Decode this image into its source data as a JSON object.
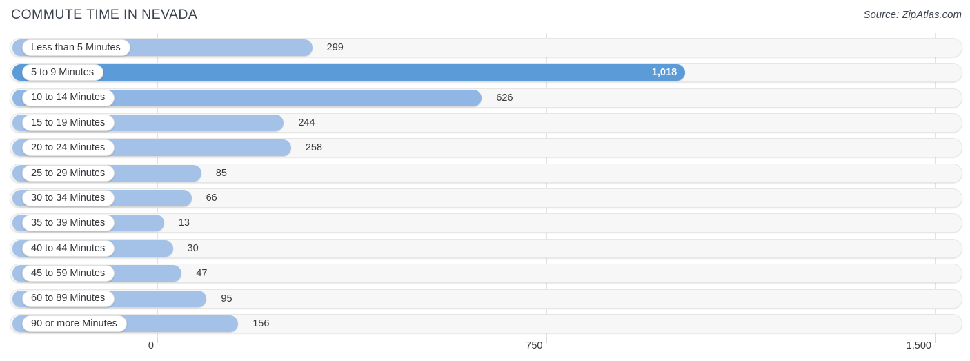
{
  "header": {
    "title": "COMMUTE TIME IN NEVADA",
    "source": "Source: ZipAtlas.com"
  },
  "colors": {
    "bar_light": "#a4c2e8",
    "bar_mid": "#8fb6e4",
    "bar_dark": "#5b9bd8",
    "track_bg": "#f7f7f7",
    "track_border": "#e6e6e6",
    "gridline": "#e3e3e3",
    "text": "#3a3a3a",
    "value_inside": "#ffffff"
  },
  "chart_data": {
    "type": "bar",
    "orientation": "horizontal",
    "title": "COMMUTE TIME IN NEVADA",
    "xlabel": "",
    "ylabel": "",
    "xlim": [
      0,
      1500
    ],
    "grid": true,
    "legend": "none",
    "axis_ticks": [
      {
        "value": 0,
        "label": "0"
      },
      {
        "value": 750,
        "label": "750"
      },
      {
        "value": 1500,
        "label": "1,500"
      }
    ],
    "categories": [
      "Less than 5 Minutes",
      "5 to 9 Minutes",
      "10 to 14 Minutes",
      "15 to 19 Minutes",
      "20 to 24 Minutes",
      "25 to 29 Minutes",
      "30 to 34 Minutes",
      "35 to 39 Minutes",
      "40 to 44 Minutes",
      "45 to 59 Minutes",
      "60 to 89 Minutes",
      "90 or more Minutes"
    ],
    "values": [
      299,
      1018,
      626,
      244,
      258,
      85,
      66,
      13,
      30,
      47,
      95,
      156
    ],
    "value_labels": [
      "299",
      "1,018",
      "626",
      "244",
      "258",
      "85",
      "66",
      "13",
      "30",
      "47",
      "95",
      "156"
    ],
    "bars": [
      {
        "label": "Less than 5 Minutes",
        "value": 299,
        "value_label": "299",
        "color": "#a4c2e8",
        "value_inside": false
      },
      {
        "label": "5 to 9 Minutes",
        "value": 1018,
        "value_label": "1,018",
        "color": "#5b9bd8",
        "value_inside": true
      },
      {
        "label": "10 to 14 Minutes",
        "value": 626,
        "value_label": "626",
        "color": "#8fb6e4",
        "value_inside": false
      },
      {
        "label": "15 to 19 Minutes",
        "value": 244,
        "value_label": "244",
        "color": "#a4c2e8",
        "value_inside": false
      },
      {
        "label": "20 to 24 Minutes",
        "value": 258,
        "value_label": "258",
        "color": "#a4c2e8",
        "value_inside": false
      },
      {
        "label": "25 to 29 Minutes",
        "value": 85,
        "value_label": "85",
        "color": "#a4c2e8",
        "value_inside": false
      },
      {
        "label": "30 to 34 Minutes",
        "value": 66,
        "value_label": "66",
        "color": "#a4c2e8",
        "value_inside": false
      },
      {
        "label": "35 to 39 Minutes",
        "value": 13,
        "value_label": "13",
        "color": "#a4c2e8",
        "value_inside": false
      },
      {
        "label": "40 to 44 Minutes",
        "value": 30,
        "value_label": "30",
        "color": "#a4c2e8",
        "value_inside": false
      },
      {
        "label": "45 to 59 Minutes",
        "value": 47,
        "value_label": "47",
        "color": "#a4c2e8",
        "value_inside": false
      },
      {
        "label": "60 to 89 Minutes",
        "value": 95,
        "value_label": "95",
        "color": "#a4c2e8",
        "value_inside": false
      },
      {
        "label": "90 or more Minutes",
        "value": 156,
        "value_label": "156",
        "color": "#a4c2e8",
        "value_inside": false
      }
    ]
  }
}
